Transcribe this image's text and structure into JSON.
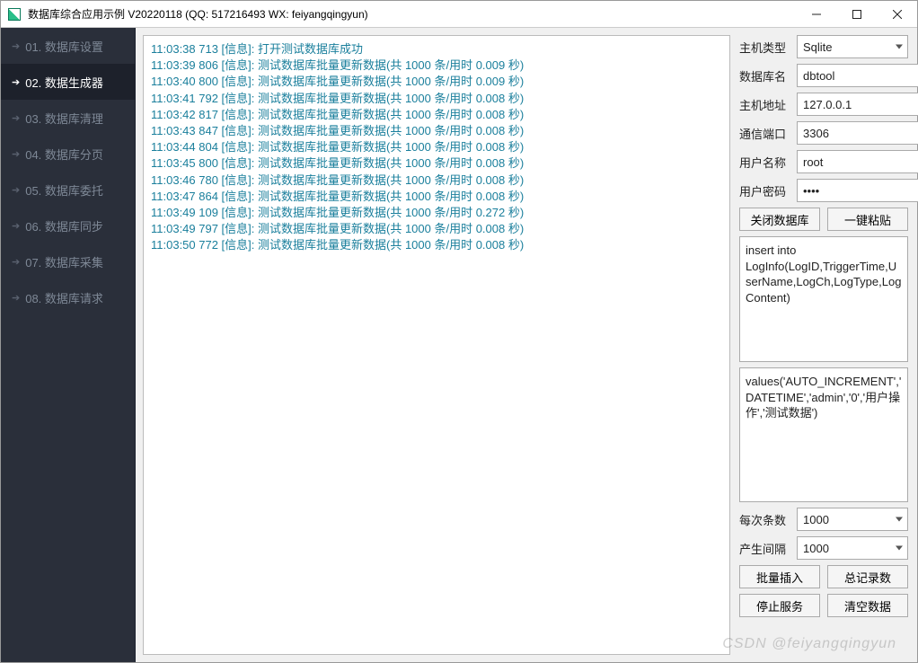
{
  "window": {
    "title": "数据库综合应用示例 V20220118 (QQ: 517216493 WX: feiyangqingyun)"
  },
  "sidebar": {
    "items": [
      {
        "label": "01. 数据库设置",
        "active": false
      },
      {
        "label": "02. 数据生成器",
        "active": true
      },
      {
        "label": "03. 数据库清理",
        "active": false
      },
      {
        "label": "04. 数据库分页",
        "active": false
      },
      {
        "label": "05. 数据库委托",
        "active": false
      },
      {
        "label": "06. 数据库同步",
        "active": false
      },
      {
        "label": "07. 数据库采集",
        "active": false
      },
      {
        "label": "08. 数据库请求",
        "active": false
      }
    ]
  },
  "log": {
    "lines": [
      "11:03:38 713 [信息]: 打开测试数据库成功",
      "11:03:39 806 [信息]: 测试数据库批量更新数据(共 1000 条/用时 0.009 秒)",
      "11:03:40 800 [信息]: 测试数据库批量更新数据(共 1000 条/用时 0.009 秒)",
      "11:03:41 792 [信息]: 测试数据库批量更新数据(共 1000 条/用时 0.008 秒)",
      "11:03:42 817 [信息]: 测试数据库批量更新数据(共 1000 条/用时 0.008 秒)",
      "11:03:43 847 [信息]: 测试数据库批量更新数据(共 1000 条/用时 0.008 秒)",
      "11:03:44 804 [信息]: 测试数据库批量更新数据(共 1000 条/用时 0.008 秒)",
      "11:03:45 800 [信息]: 测试数据库批量更新数据(共 1000 条/用时 0.008 秒)",
      "11:03:46 780 [信息]: 测试数据库批量更新数据(共 1000 条/用时 0.008 秒)",
      "11:03:47 864 [信息]: 测试数据库批量更新数据(共 1000 条/用时 0.008 秒)",
      "11:03:49 109 [信息]: 测试数据库批量更新数据(共 1000 条/用时 0.272 秒)",
      "11:03:49 797 [信息]: 测试数据库批量更新数据(共 1000 条/用时 0.008 秒)",
      "11:03:50 772 [信息]: 测试数据库批量更新数据(共 1000 条/用时 0.008 秒)"
    ]
  },
  "panel": {
    "labels": {
      "host_type": "主机类型",
      "db_name": "数据库名",
      "host_addr": "主机地址",
      "port": "通信端口",
      "user": "用户名称",
      "pass": "用户密码",
      "batch_size": "每次条数",
      "interval": "产生间隔"
    },
    "values": {
      "host_type": "Sqlite",
      "db_name": "dbtool",
      "host_addr": "127.0.0.1",
      "port": "3306",
      "user": "root",
      "pass": "••••",
      "sql1": "insert into LogInfo(LogID,TriggerTime,UserName,LogCh,LogType,LogContent)",
      "sql2": "values('AUTO_INCREMENT','DATETIME','admin','0','用户操作','测试数据')",
      "batch_size": "1000",
      "interval": "1000"
    },
    "buttons": {
      "close_db": "关闭数据库",
      "paste": "一键粘贴",
      "batch_insert": "批量插入",
      "total_count": "总记录数",
      "stop": "停止服务",
      "clear": "清空数据"
    }
  },
  "watermark": "CSDN @feiyangqingyun"
}
